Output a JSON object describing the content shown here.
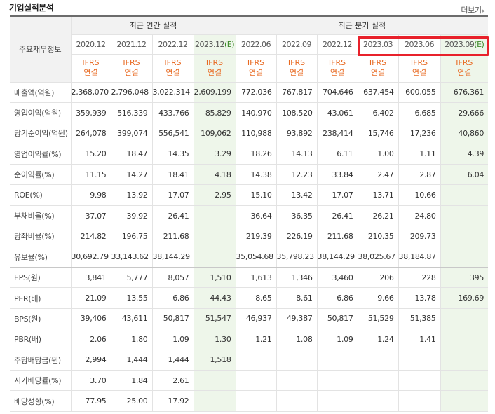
{
  "header": {
    "title": "기업실적분석",
    "more_label": "더보기",
    "more_arrow": "▸"
  },
  "table": {
    "label_header": "주요재무정보",
    "annual_group": "최근 연간 실적",
    "quarter_group": "최근 분기 실적",
    "annual_dates": [
      "2020.12",
      "2021.12",
      "2022.12",
      "2023.12(E)"
    ],
    "quarter_dates": [
      "2022.06",
      "2022.09",
      "2022.12",
      "2023.03",
      "2023.06",
      "2023.09(E)"
    ],
    "ifrs_line1": "IFRS",
    "ifrs_line2": "연결",
    "rows": [
      {
        "label": "매출액(억원)",
        "values": [
          "2,368,070",
          "2,796,048",
          "3,022,314",
          "2,609,199",
          "772,036",
          "767,817",
          "704,646",
          "637,454",
          "600,055",
          "676,361"
        ]
      },
      {
        "label": "영업이익(억원)",
        "values": [
          "359,939",
          "516,339",
          "433,766",
          "85,829",
          "140,970",
          "108,520",
          "43,061",
          "6,402",
          "6,685",
          "29,666"
        ]
      },
      {
        "label": "당기순이익(억원)",
        "values": [
          "264,078",
          "399,074",
          "556,541",
          "109,062",
          "110,988",
          "93,892",
          "238,414",
          "15,746",
          "17,236",
          "40,860"
        ]
      },
      {
        "label": "영업이익률(%)",
        "values": [
          "15.20",
          "18.47",
          "14.35",
          "3.29",
          "18.26",
          "14.13",
          "6.11",
          "1.00",
          "1.11",
          "4.39"
        ]
      },
      {
        "label": "순이익률(%)",
        "values": [
          "11.15",
          "14.27",
          "18.41",
          "4.18",
          "14.38",
          "12.23",
          "33.84",
          "2.47",
          "2.87",
          "6.04"
        ]
      },
      {
        "label": "ROE(%)",
        "values": [
          "9.98",
          "13.92",
          "17.07",
          "2.95",
          "15.10",
          "13.42",
          "17.07",
          "13.71",
          "10.66",
          ""
        ]
      },
      {
        "label": "부채비율(%)",
        "values": [
          "37.07",
          "39.92",
          "26.41",
          "",
          "36.64",
          "36.35",
          "26.41",
          "26.21",
          "24.80",
          ""
        ]
      },
      {
        "label": "당좌비율(%)",
        "values": [
          "214.82",
          "196.75",
          "211.68",
          "",
          "219.39",
          "226.19",
          "211.68",
          "210.35",
          "209.73",
          ""
        ]
      },
      {
        "label": "유보율(%)",
        "values": [
          "30,692.79",
          "33,143.62",
          "38,144.29",
          "",
          "35,054.68",
          "35,798.23",
          "38,144.29",
          "38,025.67",
          "38,184.87",
          ""
        ]
      },
      {
        "label": "EPS(원)",
        "values": [
          "3,841",
          "5,777",
          "8,057",
          "1,510",
          "1,613",
          "1,346",
          "3,460",
          "206",
          "228",
          "395"
        ]
      },
      {
        "label": "PER(배)",
        "values": [
          "21.09",
          "13.55",
          "6.86",
          "44.43",
          "8.65",
          "8.61",
          "6.86",
          "9.66",
          "13.78",
          "169.69"
        ]
      },
      {
        "label": "BPS(원)",
        "values": [
          "39,406",
          "43,611",
          "50,817",
          "51,547",
          "46,937",
          "49,387",
          "50,817",
          "51,529",
          "51,385",
          ""
        ]
      },
      {
        "label": "PBR(배)",
        "values": [
          "2.06",
          "1.80",
          "1.09",
          "1.30",
          "1.21",
          "1.08",
          "1.09",
          "1.24",
          "1.41",
          ""
        ]
      },
      {
        "label": "주당배당금(원)",
        "values": [
          "2,994",
          "1,444",
          "1,444",
          "1,518",
          "",
          "",
          "",
          "",
          "",
          ""
        ]
      },
      {
        "label": "시가배당률(%)",
        "values": [
          "3.70",
          "1.84",
          "2.61",
          "",
          "",
          "",
          "",
          "",
          "",
          ""
        ]
      },
      {
        "label": "배당성향(%)",
        "values": [
          "77.95",
          "25.00",
          "17.92",
          "",
          "",
          "",
          "",
          "",
          "",
          ""
        ]
      }
    ]
  },
  "colors": {
    "ifrs": "#e86a22",
    "estimate_bg": "#eef6ea",
    "estimate_text": "#3d8a2a",
    "highlight_border": "#e8212b"
  }
}
